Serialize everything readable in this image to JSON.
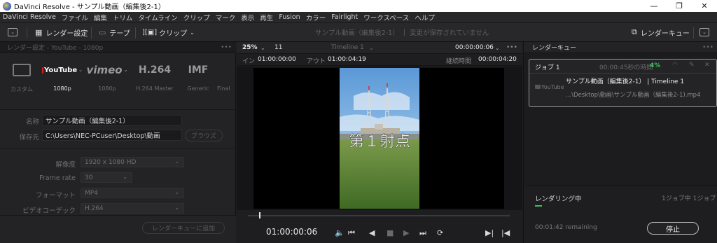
{
  "window": {
    "title": "DaVinci Resolve - サンプル動画（編集後2-1）",
    "controls": {
      "minimize": "—",
      "maximize": "❐",
      "close": "✕"
    }
  },
  "menu": [
    "DaVinci Resolve",
    "ファイル",
    "編集",
    "トリム",
    "タイムライン",
    "クリップ",
    "マーク",
    "表示",
    "再生",
    "Fusion",
    "カラー",
    "Fairlight",
    "ワークスペース",
    "ヘルプ"
  ],
  "toolbar": {
    "render_settings": "レンダー設定",
    "tape": "テープ",
    "clip": "クリップ",
    "project_status_name": "サンプル動画（編集後2-1）",
    "project_status_divider": "|",
    "project_status_msg": "変更が保存されていません",
    "render_queue": "レンダーキュー"
  },
  "left_panel": {
    "header": "レンダー設定 - YouTube - 1080p",
    "presets": [
      {
        "logo": "",
        "label": "カスタム",
        "active": false
      },
      {
        "logo": "YouTube",
        "label": "1080p",
        "active": true
      },
      {
        "logo": "vimeo",
        "label": "1080p",
        "active": false
      },
      {
        "logo": "H.264",
        "label": "H.264 Master",
        "active": false
      },
      {
        "logo": "IMF",
        "label": "Generic",
        "active": false
      },
      {
        "logo": "",
        "label": "Final",
        "active": false
      }
    ],
    "name_label": "名称",
    "name_value": "サンプル動画（編集後2-1）",
    "location_label": "保存先",
    "location_value": "C:\\Users\\NEC-PCuser\\Desktop\\動画",
    "browse": "ブラウズ",
    "resolution_label": "解像度",
    "resolution_value": "1920 x 1080 HD",
    "framerate_label": "Frame rate",
    "framerate_value": "30",
    "format_label": "フォーマット",
    "format_value": "MP4",
    "codec_label": "ビデオコーデック",
    "codec_value": "H.264",
    "add_to_queue": "レンダーキューに追加"
  },
  "viewer": {
    "zoom": "25%",
    "clip_number": "11",
    "timeline_name": "Timeline 1",
    "timecode": "00:00:00:06",
    "in_label": "イン",
    "in_value": "01:00:00:00",
    "out_label": "アウト",
    "out_value": "01:00:04:19",
    "duration_label": "継続時間",
    "duration_value": "00:00:04:20",
    "overlay_text": "第１射点",
    "current_timecode": "01:00:00:06"
  },
  "render_queue": {
    "header": "レンダーキュー",
    "job": {
      "name": "ジョブ 1",
      "time_remaining": "00:00:45秒の時間",
      "percent": "4%",
      "preset_logo": "YouTube",
      "title": "サンプル動画（編集後2-1） | Timeline 1",
      "path": "...\\Desktop\\動画\\サンプル動画（編集後2-1).mp4"
    },
    "status_label": "レンダリング中",
    "job_count": "1ジョブ中 1ジョブ",
    "remaining": "00:01:42 remaining",
    "stop": "停止"
  },
  "colors": {
    "accent_green": "#3fbf5a",
    "panel": "#232326",
    "bg": "#1e1e21"
  }
}
